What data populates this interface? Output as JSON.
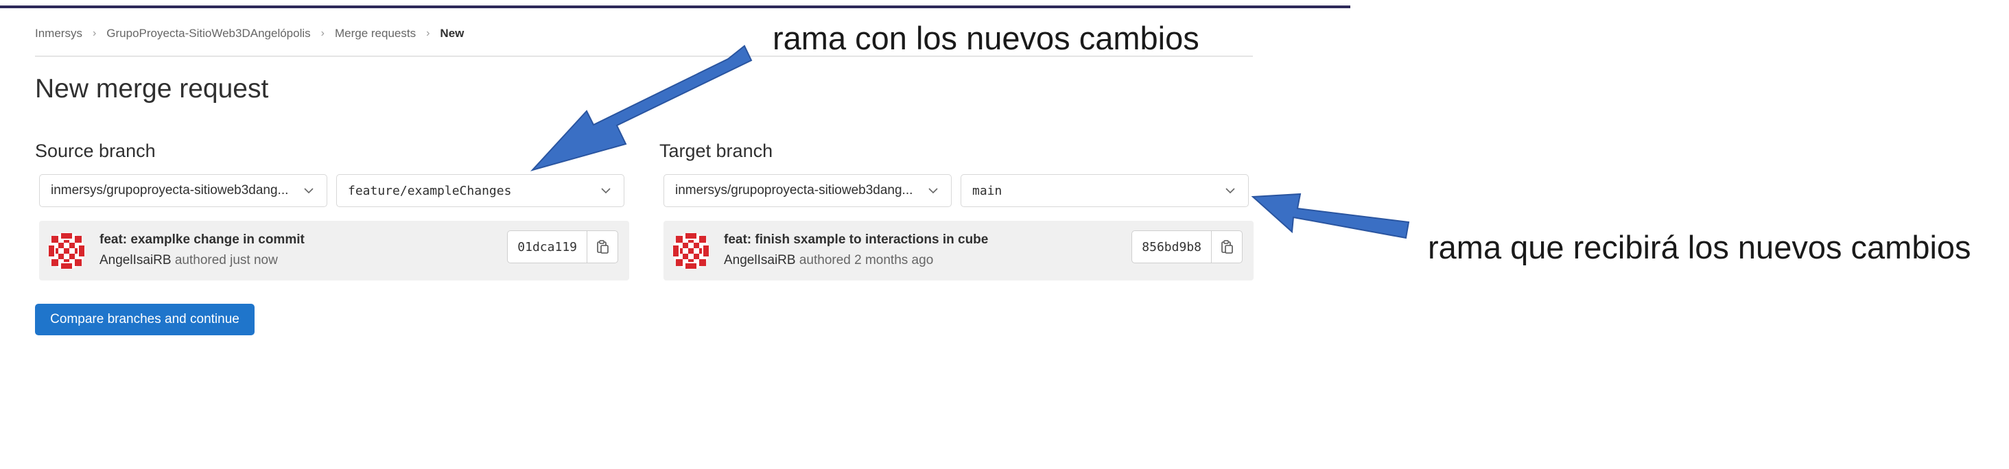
{
  "breadcrumb": {
    "items": [
      "Inmersys",
      "GrupoProyecta-SitioWeb3DAngelópolis",
      "Merge requests"
    ],
    "current": "New"
  },
  "page": {
    "title": "New merge request"
  },
  "source": {
    "label": "Source branch",
    "project": "inmersys/grupoproyecta-sitioweb3dang...",
    "branch": "feature/exampleChanges",
    "commit": {
      "title": "feat: examplke change in commit",
      "author": "AngelIsaiRB",
      "meta": "authored just now",
      "sha": "01dca119"
    }
  },
  "target": {
    "label": "Target branch",
    "project": "inmersys/grupoproyecta-sitioweb3dang...",
    "branch": "main",
    "commit": {
      "title": "feat: finish sxample to interactions in cube",
      "author": "AngelIsaiRB",
      "meta": "authored 2 months ago",
      "sha": "856bd9b8"
    }
  },
  "actions": {
    "compare_label": "Compare branches and continue"
  },
  "annotations": {
    "source_note": "rama con los nuevos cambios",
    "target_note": "rama que recibirá los nuevos cambios"
  },
  "icons": {
    "breadcrumb_separator": "chevron-right-icon",
    "dropdown": "chevron-down-icon",
    "copy": "clipboard-copy-icon",
    "avatar": "identicon-avatar"
  },
  "colors": {
    "primary_button": "#1f75cb",
    "annotation_arrow": "#3a6fc4",
    "avatar": "#d8262c",
    "commit_background": "#f0f0f0"
  }
}
